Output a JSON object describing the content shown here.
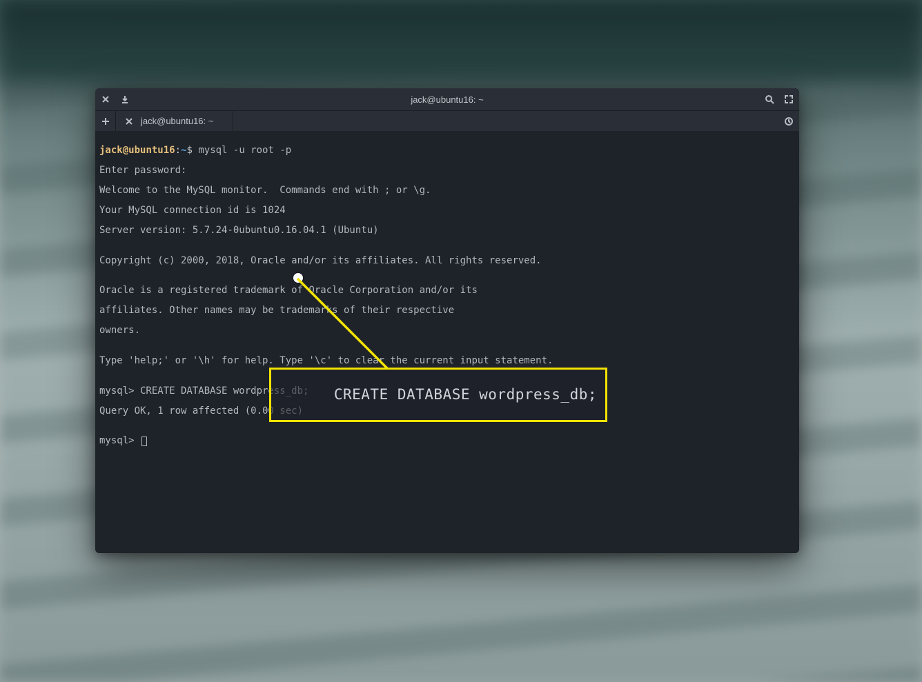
{
  "window": {
    "title": "jack@ubuntu16: ~"
  },
  "tab": {
    "label": "jack@ubuntu16: ~"
  },
  "prompt": {
    "user": "jack",
    "at": "@",
    "host": "ubuntu16",
    "colon": ":",
    "path": "~",
    "symbol": "$"
  },
  "lines": {
    "cmd1": " mysql -u root -p",
    "l1": "Enter password:",
    "l2": "Welcome to the MySQL monitor.  Commands end with ; or \\g.",
    "l3": "Your MySQL connection id is 1024",
    "l4": "Server version: 5.7.24-0ubuntu0.16.04.1 (Ubuntu)",
    "l5": "",
    "l6": "Copyright (c) 2000, 2018, Oracle and/or its affiliates. All rights reserved.",
    "l7": "",
    "l8": "Oracle is a registered trademark of Oracle Corporation and/or its",
    "l9": "affiliates. Other names may be trademarks of their respective",
    "l10": "owners.",
    "l11": "",
    "l12": "Type 'help;' or '\\h' for help. Type '\\c' to clear the current input statement.",
    "l13": "",
    "l14": "mysql> CREATE DATABASE wordpress_db;",
    "l15": "Query OK, 1 row affected (0.00 sec)",
    "l16": "",
    "l17": "mysql> "
  },
  "callout": {
    "text": "CREATE DATABASE wordpress_db;"
  }
}
